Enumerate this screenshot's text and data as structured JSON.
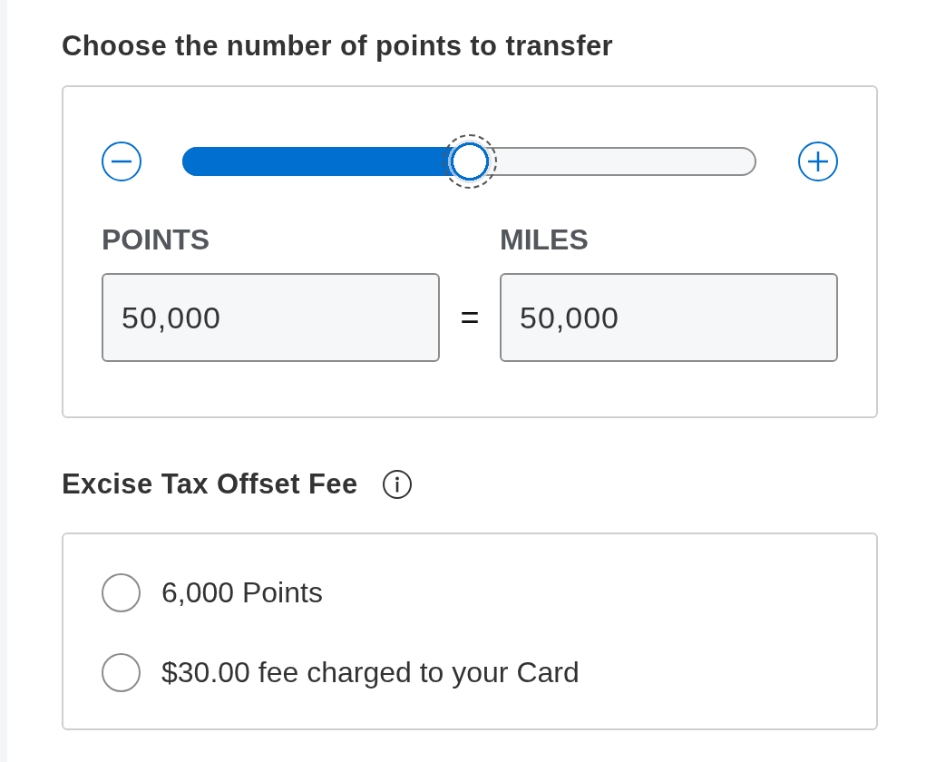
{
  "transfer": {
    "title": "Choose the number of points to transfer",
    "slider": {
      "level": 0.5,
      "focused": true
    },
    "fields": [
      {
        "label": "POINTS",
        "value": "50,000"
      },
      {
        "label": "MILES",
        "value": "50,000"
      }
    ],
    "separator": "="
  },
  "fee": {
    "title": "Excise Tax Offset Fee",
    "options": [
      {
        "label": "6,000 Points",
        "selected": false
      },
      {
        "label": "$30.00 fee charged to your Card",
        "selected": false
      }
    ]
  }
}
